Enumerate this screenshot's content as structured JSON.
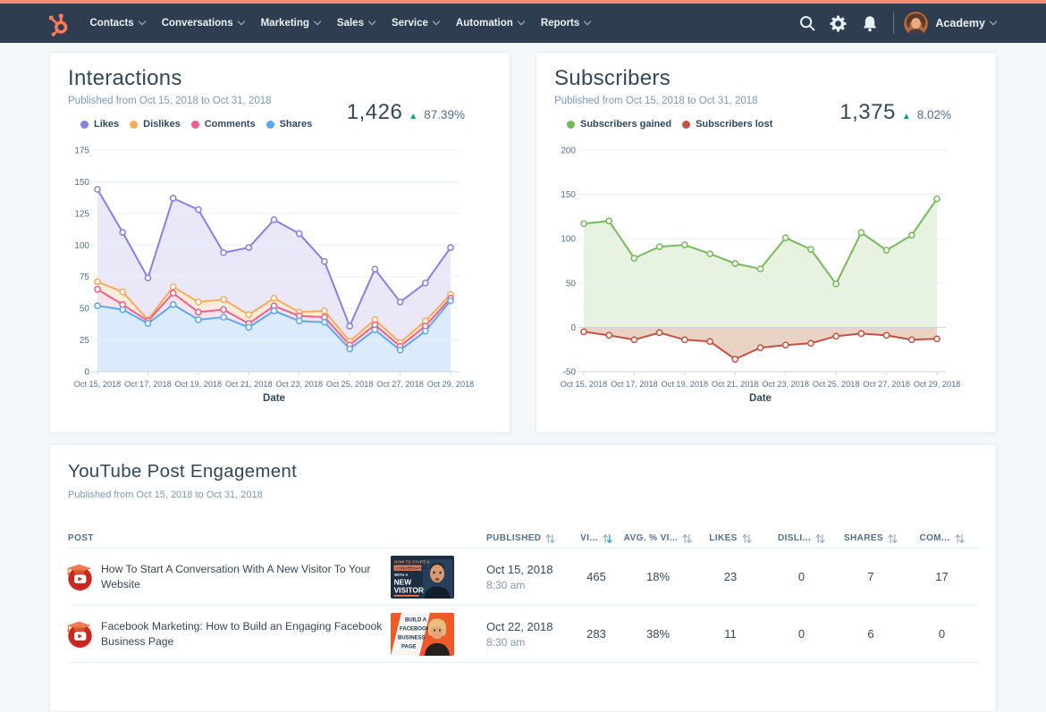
{
  "topbar": {
    "accent_color": "#f28b70",
    "bg_color": "#2e3e50",
    "nav_items": [
      "Contacts",
      "Conversations",
      "Marketing",
      "Sales",
      "Service",
      "Automation",
      "Reports"
    ],
    "icons": [
      "search-icon",
      "settings-gear-icon",
      "notifications-bell-icon"
    ],
    "account_label": "Academy"
  },
  "cards": {
    "interactions": {
      "title": "Interactions",
      "subtitle": "Published from Oct 15, 2018 to Oct 31, 2018",
      "total": "1,426",
      "delta": "87.39%",
      "delta_direction": "up"
    },
    "subscribers": {
      "title": "Subscribers",
      "subtitle": "Published from Oct 15, 2018 to Oct 31, 2018",
      "total": "1,375",
      "delta": "8.02%",
      "delta_direction": "up"
    },
    "youtube_table": {
      "title": "YouTube Post Engagement",
      "subtitle": "Published from Oct 15, 2018 to Oct 31, 2018",
      "columns": [
        {
          "id": "post",
          "label": "POST",
          "align": "left",
          "sortable": false
        },
        {
          "id": "published",
          "label": "PUBLISHED",
          "align": "left",
          "sortable": true
        },
        {
          "id": "views",
          "label": "VI...",
          "sortable": true,
          "sorted": "desc"
        },
        {
          "id": "avg_pct_viewed",
          "label": "AVG. % VI...",
          "sortable": true
        },
        {
          "id": "likes",
          "label": "LIKES",
          "sortable": true
        },
        {
          "id": "dislikes",
          "label": "DISLI...",
          "sortable": true
        },
        {
          "id": "shares",
          "label": "SHARES",
          "sortable": true
        },
        {
          "id": "comments",
          "label": "COM...",
          "sortable": true
        }
      ],
      "rows": [
        {
          "title": "How To Start A Conversation With A New Visitor To Your Website",
          "channel_icon": "youtube-academy-icon",
          "thumbnail": "thumb-new-visitor",
          "published_date": "Oct 15, 2018",
          "published_time": "8:30 am",
          "views": "465",
          "avg_pct_viewed": "18%",
          "likes": "23",
          "dislikes": "0",
          "shares": "7",
          "comments": "17"
        },
        {
          "title": "Facebook Marketing: How to Build an Engaging Facebook Business Page",
          "channel_icon": "youtube-academy-icon",
          "thumbnail": "thumb-facebook-marketing",
          "published_date": "Oct 22, 2018",
          "published_time": "8:30 am",
          "views": "283",
          "avg_pct_viewed": "38%",
          "likes": "11",
          "dislikes": "0",
          "shares": "6",
          "comments": "0"
        }
      ]
    }
  },
  "chart_data": [
    {
      "id": "interactions",
      "type": "area",
      "title": "Interactions",
      "xlabel": "Date",
      "ylabel": "",
      "ylim": [
        0,
        175
      ],
      "ytick_step": 25,
      "axis_value": 0,
      "grid": true,
      "legend_position": "top",
      "x": [
        "Oct 15, 2018",
        "Oct 16, 2018",
        "Oct 17, 2018",
        "Oct 18, 2018",
        "Oct 19, 2018",
        "Oct 20, 2018",
        "Oct 21, 2018",
        "Oct 22, 2018",
        "Oct 23, 2018",
        "Oct 24, 2018",
        "Oct 25, 2018",
        "Oct 26, 2018",
        "Oct 27, 2018",
        "Oct 28, 2018",
        "Oct 29, 2018"
      ],
      "x_label_every": 2,
      "series": [
        {
          "name": "Likes",
          "color": "#8680e0",
          "fill": "#eae7f8",
          "values": [
            144,
            110,
            74,
            137,
            128,
            94,
            98,
            120,
            109,
            87,
            36,
            81,
            55,
            70,
            98
          ]
        },
        {
          "name": "Dislikes",
          "color": "#f9ab59",
          "fill": "#fcecd9",
          "values": [
            71,
            63,
            41,
            67,
            55,
            57,
            45,
            58,
            47,
            48,
            24,
            41,
            23,
            40,
            61
          ]
        },
        {
          "name": "Comments",
          "color": "#ee5f8e",
          "fill": "#fae3ea",
          "values": [
            65,
            53,
            40,
            62,
            47,
            49,
            38,
            52,
            44,
            43,
            21,
            37,
            20,
            36,
            58
          ]
        },
        {
          "name": "Shares",
          "color": "#5ba7f2",
          "fill": "#dcebfb",
          "values": [
            52,
            49,
            38,
            53,
            41,
            43,
            35,
            48,
            40,
            39,
            18,
            33,
            17,
            32,
            56
          ]
        }
      ]
    },
    {
      "id": "subscribers",
      "type": "area",
      "title": "Subscribers",
      "xlabel": "Date",
      "ylabel": "",
      "ylim": [
        -50,
        200
      ],
      "ytick_step": 50,
      "axis_value": -50,
      "grid": true,
      "legend_position": "top",
      "x": [
        "Oct 15, 2018",
        "Oct 16, 2018",
        "Oct 17, 2018",
        "Oct 18, 2018",
        "Oct 19, 2018",
        "Oct 20, 2018",
        "Oct 21, 2018",
        "Oct 22, 2018",
        "Oct 23, 2018",
        "Oct 24, 2018",
        "Oct 25, 2018",
        "Oct 26, 2018",
        "Oct 27, 2018",
        "Oct 28, 2018",
        "Oct 29, 2018"
      ],
      "x_label_every": 2,
      "series": [
        {
          "name": "Subscribers gained",
          "color": "#77b85e",
          "fill": "#e7f2e0",
          "values": [
            117,
            120,
            78,
            91,
            93,
            83,
            72,
            66,
            101,
            88,
            49,
            107,
            87,
            104,
            145
          ]
        },
        {
          "name": "Subscribers lost",
          "color": "#c65140",
          "fill": "#e9d3c4",
          "values": [
            -5,
            -9,
            -14,
            -6,
            -14,
            -16,
            -36,
            -23,
            -20,
            -18,
            -10,
            -7,
            -9,
            -14,
            -13
          ]
        }
      ]
    }
  ]
}
